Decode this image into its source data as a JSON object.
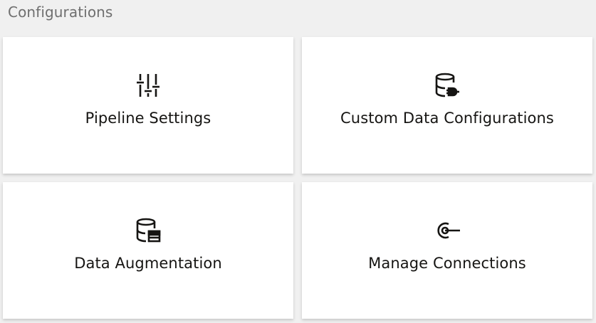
{
  "page": {
    "title": "Configurations"
  },
  "cards": [
    {
      "label": "Pipeline Settings",
      "icon": "sliders-icon"
    },
    {
      "label": "Custom Data Configurations",
      "icon": "database-plug-icon"
    },
    {
      "label": "Data Augmentation",
      "icon": "database-table-icon"
    },
    {
      "label": "Manage Connections",
      "icon": "connection-icon"
    }
  ]
}
